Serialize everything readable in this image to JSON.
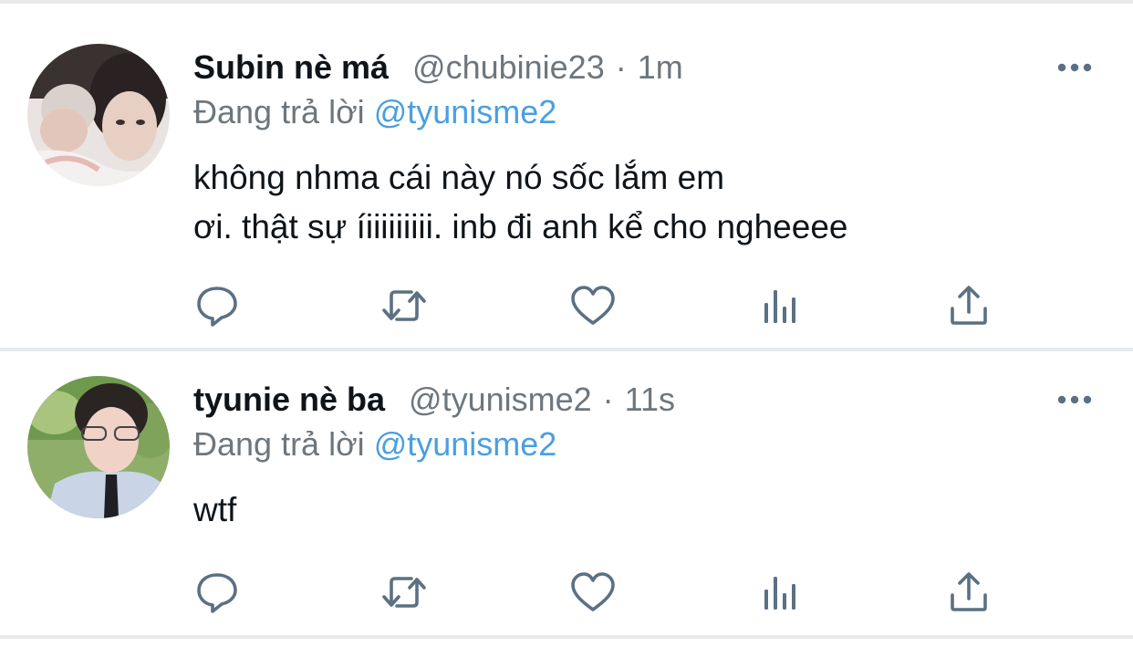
{
  "colors": {
    "text": "#0f1419",
    "secondary": "#6e767d",
    "mention": "#4a9fe0",
    "icon": "#5b7083",
    "divider": "#e7e9eb"
  },
  "tweets": [
    {
      "display_name": "Subin nè má",
      "handle": "@chubinie23",
      "separator": "·",
      "time": "1m",
      "reply_prefix": "Đang trả lời",
      "reply_to": "@tyunisme2",
      "text_line1": "không nhma cái này nó sốc lắm em",
      "text_line2": "ơi. thật sự íiiiiiiiii. inb đi anh kể cho ngheeee",
      "avatar_icon": "user-avatar-photo",
      "more_icon": "more-horizontal-icon",
      "actions": [
        "reply-icon",
        "retweet-icon",
        "like-icon",
        "analytics-icon",
        "share-icon"
      ]
    },
    {
      "display_name": "tyunie nè ba",
      "handle": "@tyunisme2",
      "separator": "·",
      "time": "11s",
      "reply_prefix": "Đang trả lời",
      "reply_to": "@tyunisme2",
      "text_line1": "wtf",
      "avatar_icon": "user-avatar-photo",
      "more_icon": "more-horizontal-icon",
      "actions": [
        "reply-icon",
        "retweet-icon",
        "like-icon",
        "analytics-icon",
        "share-icon"
      ]
    }
  ]
}
